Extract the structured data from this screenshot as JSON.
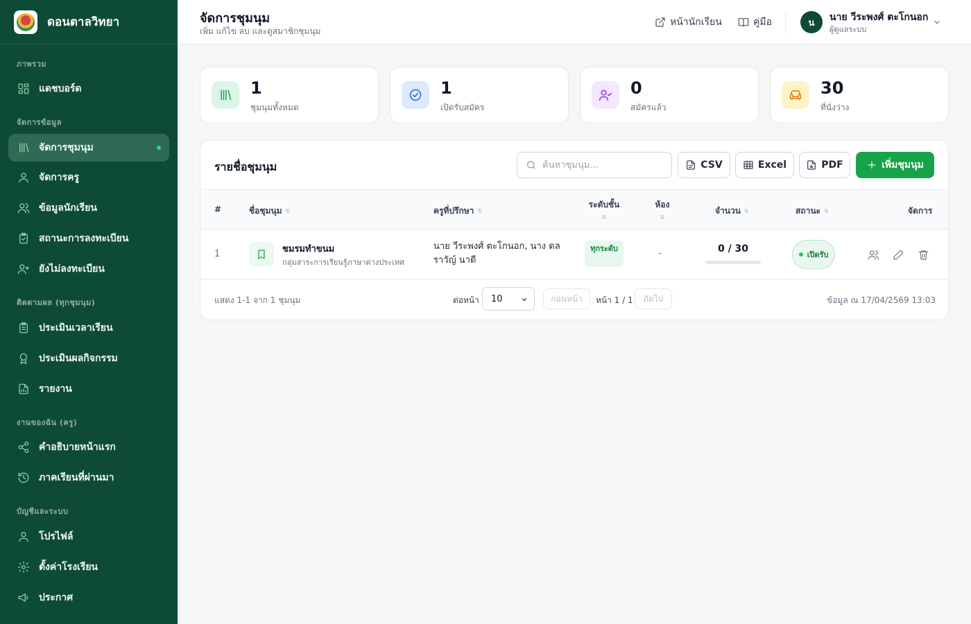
{
  "app": {
    "name": "ดอนตาลวิทยา"
  },
  "sidebar": {
    "sections": [
      {
        "label": "ภาพรวม"
      },
      {
        "label": "จัดการข้อมูล"
      },
      {
        "label": "ติดตามผล (ทุกชุมนุม)"
      },
      {
        "label": "งานของฉัน (ครู)"
      },
      {
        "label": "บัญชีและระบบ"
      }
    ],
    "items": [
      {
        "label": "แดชบอร์ด",
        "icon": "dashboard-icon"
      },
      {
        "label": "จัดการชุมนุม",
        "icon": "library-icon",
        "active": true
      },
      {
        "label": "จัดการครู",
        "icon": "user-icon"
      },
      {
        "label": "ข้อมูลนักเรียน",
        "icon": "users-icon"
      },
      {
        "label": "สถานะการลงทะเบียน",
        "icon": "clipboard-check-icon"
      },
      {
        "label": "ยังไม่ลงทะเบียน",
        "icon": "user-x-icon"
      },
      {
        "label": "ประเมินเวลาเรียน",
        "icon": "clipboard-list-icon"
      },
      {
        "label": "ประเมินผลกิจกรรม",
        "icon": "award-icon"
      },
      {
        "label": "รายงาน",
        "icon": "file-chart-icon"
      },
      {
        "label": "คำอธิบายหน้าแรก",
        "icon": "share-icon"
      },
      {
        "label": "ภาคเรียนที่ผ่านมา",
        "icon": "history-icon"
      },
      {
        "label": "โปรไฟล์",
        "icon": "user-icon"
      },
      {
        "label": "ตั้งค่าโรงเรียน",
        "icon": "gear-icon"
      },
      {
        "label": "ประกาศ",
        "icon": "megaphone-icon"
      }
    ]
  },
  "header": {
    "title": "จัดการชุมนุม",
    "subtitle": "เพิ่ม แก้ไข ลบ และดูสมาชิกชุมนุม",
    "student_page_label": "หน้านักเรียน",
    "manual_label": "คู่มือ",
    "user": {
      "initial": "น",
      "name": "นาย วีระพงศ์ ตะโกนอก",
      "role": "ผู้ดูแลระบบ"
    }
  },
  "stats": [
    {
      "value": "1",
      "label": "ชุมนุมทั้งหมด",
      "icon": "library-icon",
      "color": "#16a34a",
      "bg": "#dcf5e6"
    },
    {
      "value": "1",
      "label": "เปิดรับสมัคร",
      "icon": "check-circle-icon",
      "color": "#2563eb",
      "bg": "#dbeafe"
    },
    {
      "value": "0",
      "label": "สมัครแล้ว",
      "icon": "user-check-icon",
      "color": "#9333ea",
      "bg": "#f3e8ff"
    },
    {
      "value": "30",
      "label": "ที่นั่งว่าง",
      "icon": "sofa-icon",
      "color": "#d97706",
      "bg": "#fef3c7"
    }
  ],
  "table": {
    "title": "รายชื่อชุมนุม",
    "search_placeholder": "ค้นหาชุมนุม...",
    "buttons": {
      "csv": "CSV",
      "excel": "Excel",
      "pdf": "PDF",
      "add": "เพิ่มชุมนุม"
    },
    "columns": {
      "index": "#",
      "name": "ชื่อชุมนุม",
      "advisor": "ครูที่ปรึกษา",
      "level": "ระดับชั้น",
      "room": "ห้อง",
      "count": "จำนวน",
      "status": "สถานะ",
      "actions": "จัดการ"
    },
    "rows": [
      {
        "index": "1",
        "name": "ชมรมทำขนม",
        "description": "กลุ่มสาระการเรียนรู้ภาษาต่างประเทศ",
        "advisor": "นาย วีระพงศ์ ตะโกนอก, นาง ดลราวัญ์ นาดี",
        "level": "ทุกระดับ",
        "room": "-",
        "count": "0 / 30",
        "fill": 0,
        "status": "เปิดรับ"
      }
    ],
    "footer": {
      "showing": "แสดง 1-1 จาก 1 ชุมนุม",
      "per_page_label": "ต่อหน้า",
      "per_page_value": "10",
      "prev_label": "ก่อนหน้า",
      "page_info": "หน้า 1 / 1",
      "next_label": "ถัดไป",
      "data_as_of": "ข้อมูล ณ 17/04/2569 13:03"
    }
  }
}
